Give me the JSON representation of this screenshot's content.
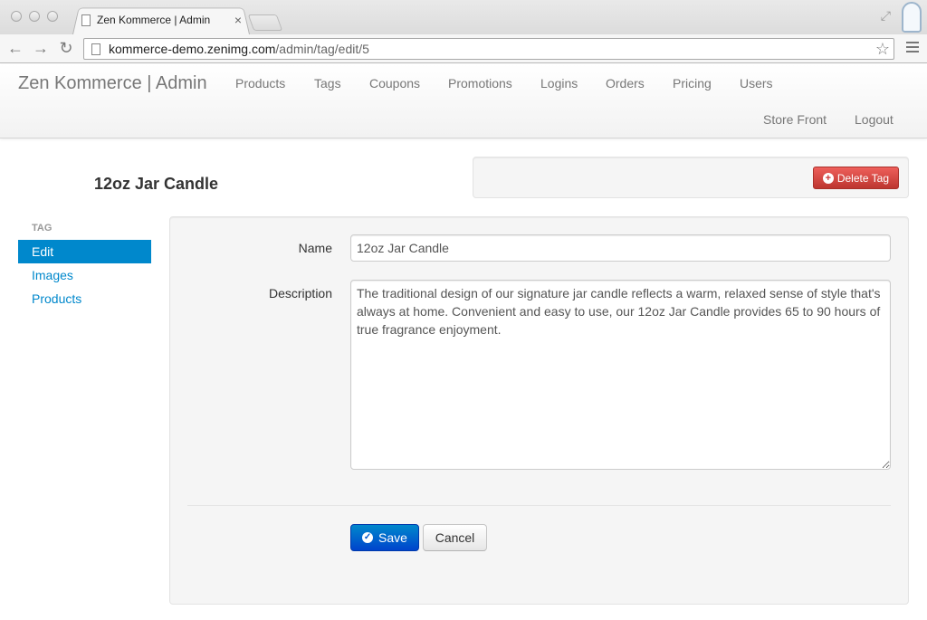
{
  "browser": {
    "tab_title": "Zen Kommerce | Admin",
    "tab_close": "×",
    "url_host": "kommerce-demo.zenimg.com",
    "url_path": "/admin/tag/edit/5",
    "back_icon": "←",
    "forward_icon": "→",
    "reload_icon": "↻",
    "star_icon": "☆",
    "fullscreen_icon": "⤢"
  },
  "navbar": {
    "brand": "Zen Kommerce | Admin",
    "items": [
      {
        "label": "Products"
      },
      {
        "label": "Tags"
      },
      {
        "label": "Coupons"
      },
      {
        "label": "Promotions"
      },
      {
        "label": "Logins"
      },
      {
        "label": "Orders"
      },
      {
        "label": "Pricing"
      },
      {
        "label": "Users"
      },
      {
        "label": "Store Front"
      },
      {
        "label": "Logout"
      }
    ]
  },
  "page": {
    "title": "12oz Jar Candle",
    "delete_button": "Delete Tag",
    "delete_icon": "+"
  },
  "sidebar": {
    "header": "Tag",
    "items": [
      {
        "label": "Edit",
        "active": true
      },
      {
        "label": "Images",
        "active": false
      },
      {
        "label": "Products",
        "active": false
      }
    ]
  },
  "form": {
    "name_label": "Name",
    "name_value": "12oz Jar Candle",
    "description_label": "Description",
    "description_value": "The traditional design of our signature jar candle reflects a warm, relaxed sense of style that's always at home. Convenient and easy to use, our 12oz Jar Candle provides 65 to 90 hours of true fragrance enjoyment.",
    "save_label": "Save",
    "save_icon": "✓",
    "cancel_label": "Cancel"
  },
  "colors": {
    "link": "#0088cc",
    "danger": "#da4f49",
    "primary": "#0055cc"
  }
}
